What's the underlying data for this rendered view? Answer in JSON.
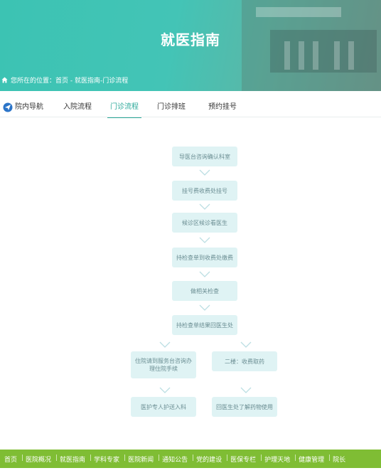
{
  "banner": {
    "title": "就医指南"
  },
  "breadcrumb": {
    "text": "您所在的位置：首页 - 就医指南-门诊流程"
  },
  "tabs": [
    {
      "label": "院内导航"
    },
    {
      "label": "入院流程"
    },
    {
      "label": "门诊流程"
    },
    {
      "label": "门诊排班"
    },
    {
      "label": "预约挂号"
    }
  ],
  "flow": {
    "steps": [
      "导医台咨询确认科室",
      "挂号费收费处挂号",
      "候诊区候诊看医生",
      "持检查单到收费处缴费",
      "做相关检查",
      "持检查单结果回医生处",
      "住院请到服务台咨询办理住院手续",
      "二楼：收费取药",
      "医护专人护送入科",
      "回医生处了解药物使用"
    ]
  },
  "footer": {
    "items": [
      "首页",
      "医院概况",
      "就医指南",
      "学科专家",
      "医院新闻",
      "通知公告",
      "党的建设",
      "医保专栏",
      "护理天地",
      "健康管理",
      "院长"
    ]
  },
  "colors": {
    "accent": "#2aa899",
    "footer": "#7fbd34",
    "step_bg": "#dff3f4"
  }
}
